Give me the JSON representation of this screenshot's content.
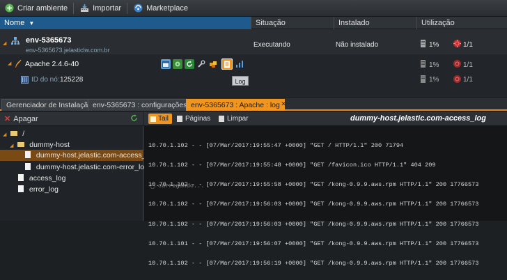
{
  "toolbar": {
    "create_env": "Criar ambiente",
    "import": "Importar",
    "marketplace": "Marketplace"
  },
  "columns": {
    "name": "Nome",
    "status": "Situação",
    "installed": "Instalado",
    "usage": "Utilização"
  },
  "env": {
    "name": "env-5365673",
    "url": "env-5365673.jelasticlw.com.br",
    "status": "Executando",
    "installed": "Não instalado",
    "usage_pct": "1%",
    "usage_count": "1/1"
  },
  "apache": {
    "name": "Apache 2.4.6-40",
    "usage_pct": "1%",
    "usage_count": "1/1"
  },
  "node": {
    "label": "ID do nó:",
    "id": "125228",
    "usage_pct": "1%",
    "usage_count": "1/1"
  },
  "tooltip": "Log",
  "tabs": [
    {
      "label": "Gerenciador de Instalação"
    },
    {
      "label": "env-5365673 : configurações"
    },
    {
      "label": "env-5365673 : Apache : log"
    }
  ],
  "left_toolbar": {
    "delete": "Apagar"
  },
  "tree": {
    "root": "/",
    "folder": "dummy-host",
    "file1": "dummy-host.jelastic.com-access_log",
    "file2": "dummy-host.jelastic.com-error_log",
    "file3": "access_log",
    "file4": "error_log"
  },
  "right_toolbar": {
    "tail": "Tail",
    "pages": "Páginas",
    "clear": "Limpar",
    "title": "dummy-host.jelastic.com-access_log"
  },
  "log_lines": [
    "10.70.1.102 - - [07/Mar/2017:19:55:47 +0000] \"GET / HTTP/1.1\" 200 71794",
    "10.70.1.102 - - [07/Mar/2017:19:55:48 +0000] \"GET /favicon.ico HTTP/1.1\" 404 209",
    "10.70.1.102 - - [07/Mar/2017:19:55:58 +0000] \"GET /kong-0.9.9.aws.rpm HTTP/1.1\" 200 17766573",
    "10.70.1.102 - - [07/Mar/2017:19:56:03 +0000] \"GET /kong-0.9.9.aws.rpm HTTP/1.1\" 200 17766573",
    "10.70.1.102 - - [07/Mar/2017:19:56:03 +0000] \"GET /kong-0.9.9.aws.rpm HTTP/1.1\" 200 17766573",
    "10.70.1.101 - - [07/Mar/2017:19:56:07 +0000] \"GET /kong-0.9.9.aws.rpm HTTP/1.1\" 200 17766573",
    "10.70.1.102 - - [07/Mar/2017:19:56:19 +0000] \"GET /kong-0.9.9.aws.rpm HTTP/1.1\" 200 17766573"
  ],
  "loading": "carregando..."
}
